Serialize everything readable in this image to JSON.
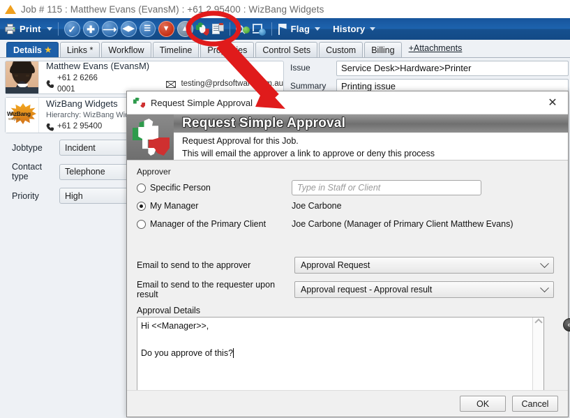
{
  "window": {
    "title": "Job # 115 : Matthew Evans (EvansM) : +61 2 95400 : WizBang Widgets"
  },
  "toolbar": {
    "print_label": "Print",
    "flag_label": "Flag",
    "history_label": "History",
    "icons": [
      "check-icon",
      "plus-icon",
      "arrow-right-icon",
      "arrow-left-right-icon",
      "list-icon",
      "chevron-down-circle-icon",
      "chevron-up-circle-icon",
      "approval-thumbs-icon",
      "document-clock-icon",
      "search-person-icon",
      "screen-globe-icon",
      "flag-icon"
    ]
  },
  "tabs": {
    "items": [
      {
        "label": "Details",
        "active": true,
        "star": "★"
      },
      {
        "label": "Links *",
        "active": false,
        "star": ""
      },
      {
        "label": "Workflow",
        "active": false,
        "star": ""
      },
      {
        "label": "Timeline",
        "active": false,
        "star": ""
      },
      {
        "label": "Properties",
        "active": false,
        "star": ""
      },
      {
        "label": "Control Sets",
        "active": false,
        "star": ""
      },
      {
        "label": "Custom",
        "active": false,
        "star": ""
      },
      {
        "label": "Billing",
        "active": false,
        "star": ""
      }
    ],
    "attachments_link": "+Attachments"
  },
  "job": {
    "person": {
      "name": "Matthew Evans (EvansM)",
      "phone": "+61 2 6266 0001",
      "email": "testing@prdsoftware.com.au"
    },
    "company": {
      "name": "WizBang Widgets",
      "hierarchy": "Hierarchy: WizBang Widgets",
      "phone": "+61 2 95400",
      "logo_text": "WizBang",
      "logo_sub": "widgets"
    },
    "fields": [
      {
        "label": "Jobtype",
        "value": "Incident"
      },
      {
        "label": "Contact type",
        "value": "Telephone"
      },
      {
        "label": "Priority",
        "value": "High"
      }
    ],
    "right_fields": [
      {
        "label": "Issue",
        "value": "Service Desk>Hardware>Printer"
      },
      {
        "label": "Summary",
        "value": "Printing issue"
      }
    ]
  },
  "dialog": {
    "titlebar_text": "Request Simple Approval",
    "close_glyph": "✕",
    "banner": {
      "heading": "Request Simple Approval",
      "line1": "Request Approval for this Job.",
      "line2": "This will email the approver a link to approve or deny this process"
    },
    "approver": {
      "section_label": "Approver",
      "options": [
        {
          "label": "Specific Person",
          "selected": false,
          "value": "",
          "placeholder": "Type in Staff or Client",
          "is_input": true
        },
        {
          "label": "My Manager",
          "selected": true,
          "value": "Joe Carbone",
          "is_input": false
        },
        {
          "label": "Manager of the Primary Client",
          "selected": false,
          "value": "Joe Carbone (Manager of Primary Client Matthew Evans)",
          "is_input": false
        }
      ]
    },
    "emails": [
      {
        "label": "Email to send to the approver",
        "value": "Approval Request"
      },
      {
        "label": "Email to send to the requester upon result",
        "value": "Approval request - Approval result"
      }
    ],
    "details": {
      "label": "Approval Details",
      "line1": "Hi <<Manager>>,",
      "line2": "",
      "line3": "Do you approve of this?"
    },
    "collapse_glyph": "«",
    "buttons": {
      "ok": "OK",
      "cancel": "Cancel"
    }
  },
  "annotation": {
    "color": "#e01b1b",
    "shape": "ellipse-and-arrow"
  }
}
